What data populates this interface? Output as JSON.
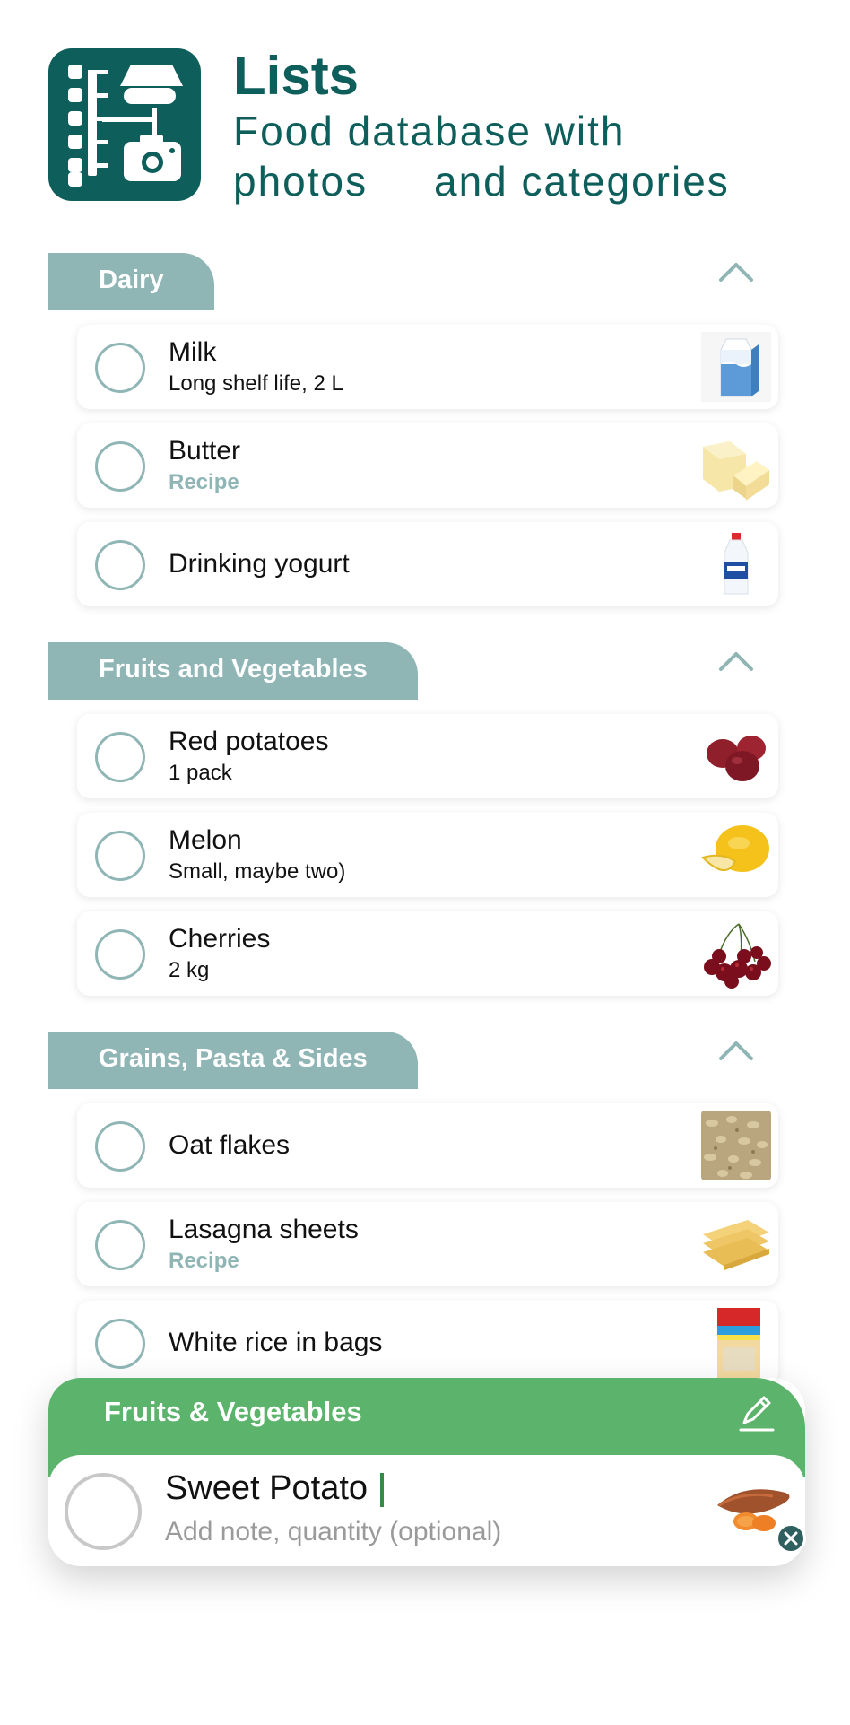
{
  "app": {
    "title": "Lists",
    "subtitle": "Food database with\nphotos     and categories"
  },
  "sections": [
    {
      "title": "Dairy",
      "items": [
        {
          "name": "Milk",
          "note": "Long shelf life, 2 L",
          "thumb": "milk-carton"
        },
        {
          "name": "Butter",
          "note": "Recipe",
          "thumb": "butter"
        },
        {
          "name": "Drinking yogurt",
          "note": "",
          "thumb": "yogurt-bottle"
        }
      ]
    },
    {
      "title": "Fruits and Vegetables",
      "items": [
        {
          "name": "Red potatoes",
          "note": "1 pack",
          "thumb": "red-potatoes"
        },
        {
          "name": "Melon",
          "note": "Small, maybe two)",
          "thumb": "melon"
        },
        {
          "name": "Cherries",
          "note": "2 kg",
          "thumb": "cherries"
        }
      ]
    },
    {
      "title": "Grains, Pasta & Sides",
      "items": [
        {
          "name": "Oat flakes",
          "note": "",
          "thumb": "oat-flakes"
        },
        {
          "name": "Lasagna sheets",
          "note": "Recipe",
          "thumb": "lasagna-sheets"
        },
        {
          "name": "White rice in bags",
          "note": "",
          "thumb": "rice-box"
        }
      ]
    }
  ],
  "editor": {
    "category": "Fruits & Vegetables",
    "name_value": "Sweet Potato",
    "note_placeholder": "Add note, quantity (optional)",
    "thumb": "sweet-potato"
  },
  "colors": {
    "brand": "#0e5e5c",
    "section_tab": "#8fb5b5",
    "editor_bar": "#5cb36b"
  }
}
